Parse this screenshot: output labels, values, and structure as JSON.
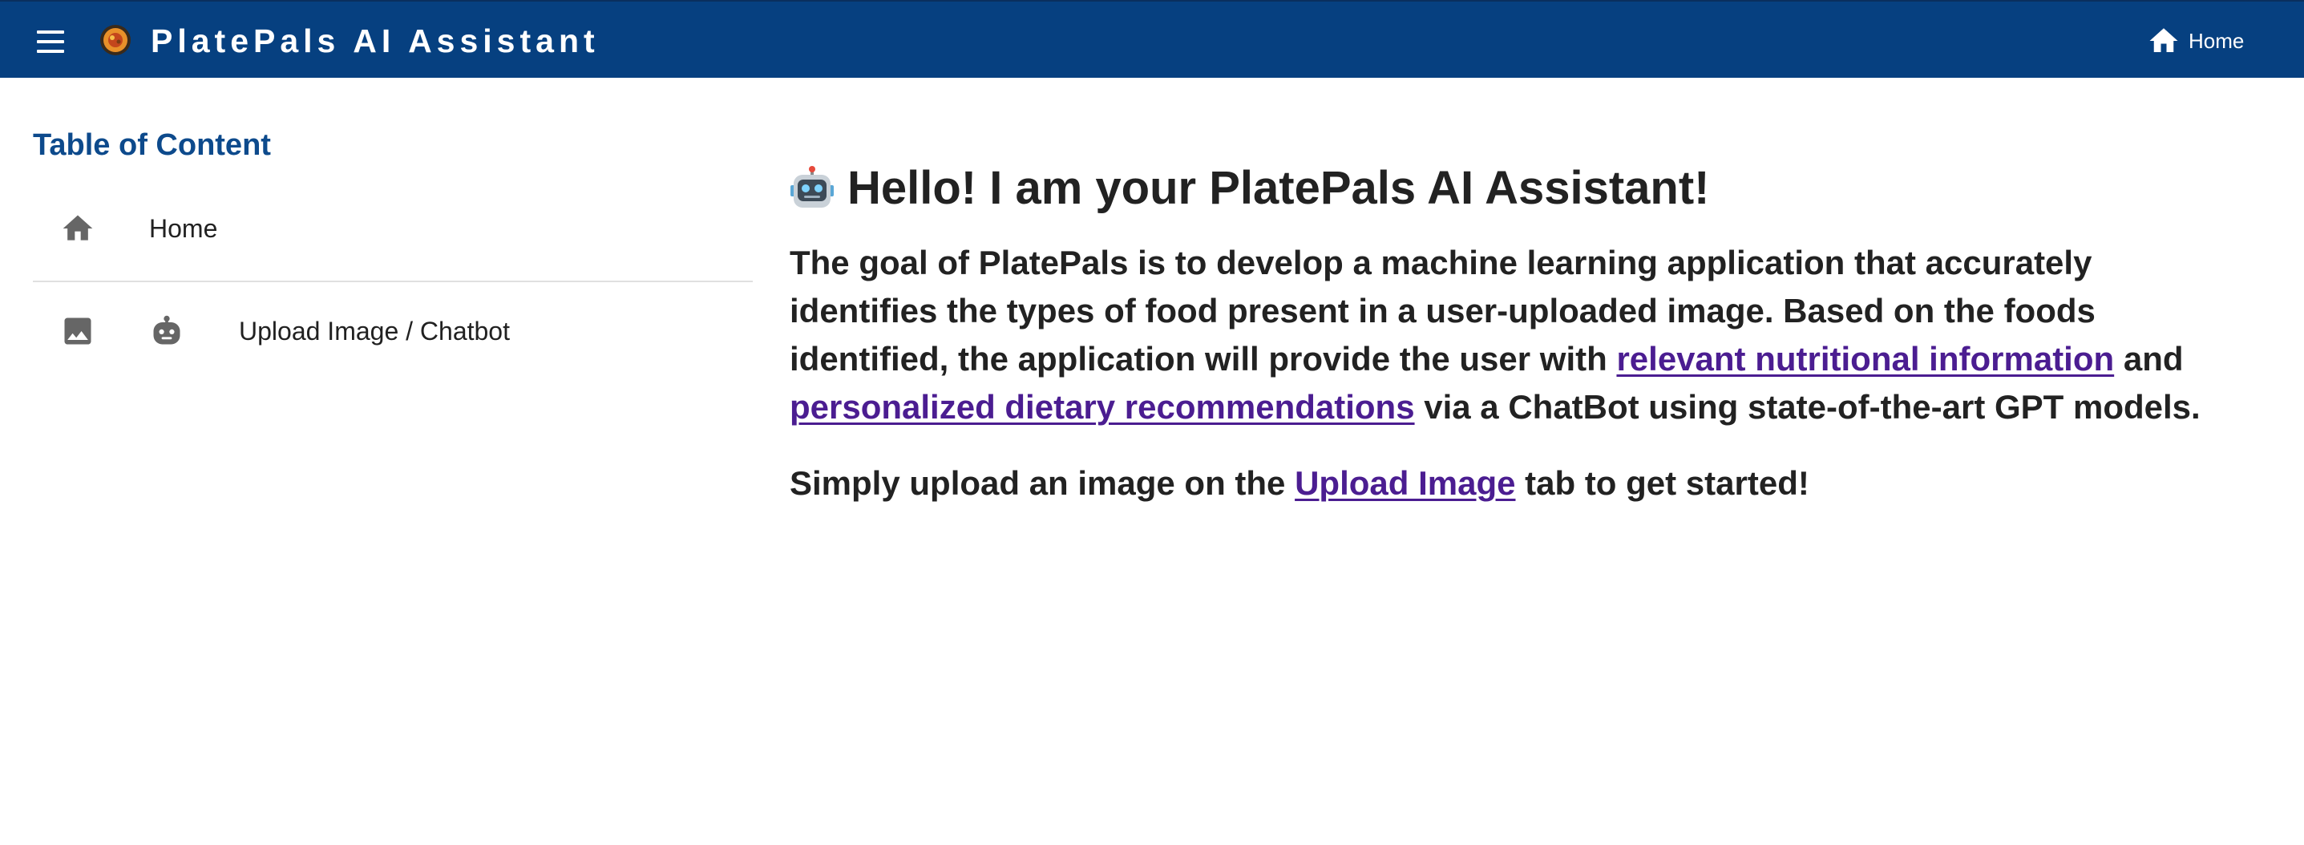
{
  "header": {
    "title": "PlatePals AI Assistant",
    "home_label": "Home",
    "background_color": "#064080",
    "menu_icon": "hamburger-menu-icon",
    "logo_icon": "platepals-logo-icon",
    "home_icon": "home-icon"
  },
  "sidebar": {
    "title": "Table of Content",
    "items": [
      {
        "label": "Home",
        "icons": [
          "home-icon"
        ]
      },
      {
        "label": "Upload Image / Chatbot",
        "icons": [
          "image-icon",
          "robot-icon"
        ]
      }
    ]
  },
  "main": {
    "heading_emoji": "robot-face-emoji",
    "heading": "Hello! I am your PlatePals AI Assistant!",
    "paragraph1": {
      "text_a": "The goal of PlatePals is to develop a machine learning application that accurately identifies the types of food present in a user-uploaded image. Based on the foods identified, the application will provide the user with ",
      "link1": "relevant nutritional information",
      "text_b": " and ",
      "link2": "personalized dietary recommendations",
      "text_c": " via a ChatBot using state-of-the-art GPT models."
    },
    "paragraph2": {
      "text_a": "Simply upload an image on the ",
      "link": "Upload Image",
      "text_b": " tab to get started!"
    }
  },
  "colors": {
    "accent": "#0d4a8c",
    "link": "#4b1d91",
    "text": "#222222"
  }
}
